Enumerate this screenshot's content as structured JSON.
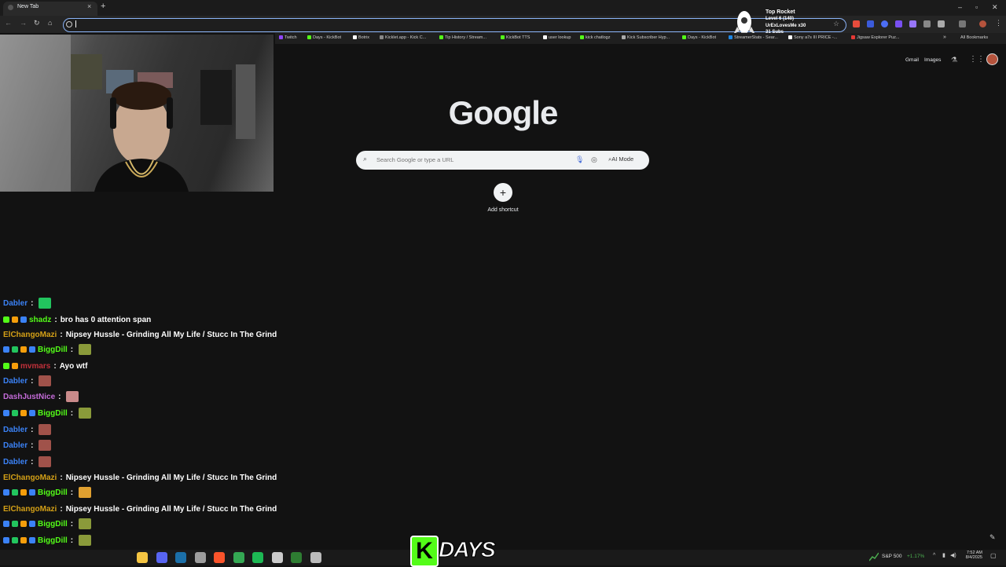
{
  "browser": {
    "tab_title": "New Tab",
    "tab_close": "×",
    "new_tab": "+",
    "bookmarks": [
      {
        "label": "Twitch",
        "color": "#9146ff"
      },
      {
        "label": "Days - KickBot",
        "color": "#53fc18"
      },
      {
        "label": "Botrix",
        "color": "#ffffff"
      },
      {
        "label": "Kicklet.app - Kick C...",
        "color": "#888888"
      },
      {
        "label": "Tip History / Stream...",
        "color": "#53fc18"
      },
      {
        "label": "KickBot TTS",
        "color": "#53fc18"
      },
      {
        "label": "user lookup",
        "color": "#ffffff"
      },
      {
        "label": "kick chatlogz",
        "color": "#53fc18"
      },
      {
        "label": "Kick Subscriber Hyp...",
        "color": "#aaaaaa"
      },
      {
        "label": "Days - KickBot",
        "color": "#53fc18"
      },
      {
        "label": "StreamerStats - Sear...",
        "color": "#1e88e5"
      },
      {
        "label": "Sony a7s III PRICE -...",
        "color": "#ffffff"
      },
      {
        "label": "Jigsaw Explorer Puz...",
        "color": "#e53935"
      }
    ],
    "all_bookmarks": "All Bookmarks",
    "more_bookmarks": "»"
  },
  "rocket_overlay": {
    "title": "Top Rocket",
    "lines": [
      "Level 6 (140)",
      "UrExLovesMe x30",
      "31 Subs"
    ]
  },
  "google": {
    "gmail": "Gmail",
    "images": "Images",
    "logo": "Google",
    "search_placeholder": "Search Google or type a URL",
    "ai_mode": "AI Mode",
    "add_shortcut_icon": "+",
    "add_shortcut_label": "Add shortcut"
  },
  "chat": [
    {
      "user": "Dabler",
      "color": "#3b82f6",
      "badges": [],
      "message": "",
      "emote": "#22c55e"
    },
    {
      "user": "shadz",
      "color": "#53fc18",
      "badges": [
        "#53fc18",
        "#f59e0b",
        "#3b82f6"
      ],
      "message": "bro has 0 attention span",
      "emote": ""
    },
    {
      "user": "ElChangoMazi",
      "color": "#d4a017",
      "badges": [],
      "message": "Nipsey Hussle - Grinding All My Life / Stucc In The Grind",
      "emote": ""
    },
    {
      "user": "BiggDill",
      "color": "#53fc18",
      "badges": [
        "#3b82f6",
        "#22c55e",
        "#f59e0b",
        "#3b82f6"
      ],
      "message": "",
      "emote": "#8a9a3a"
    },
    {
      "user": "mvmars",
      "color": "#c0303a",
      "badges": [
        "#53fc18",
        "#f59e0b"
      ],
      "message": "Ayo wtf",
      "emote": ""
    },
    {
      "user": "Dabler",
      "color": "#3b82f6",
      "badges": [],
      "message": "",
      "emote": "#a0524a"
    },
    {
      "user": "DashJustNice",
      "color": "#c46bd8",
      "badges": [],
      "message": "",
      "emote": "#c98a8a"
    },
    {
      "user": "BiggDill",
      "color": "#53fc18",
      "badges": [
        "#3b82f6",
        "#22c55e",
        "#f59e0b",
        "#3b82f6"
      ],
      "message": "",
      "emote": "#8a9a3a"
    },
    {
      "user": "Dabler",
      "color": "#3b82f6",
      "badges": [],
      "message": "",
      "emote": "#a0524a"
    },
    {
      "user": "Dabler",
      "color": "#3b82f6",
      "badges": [],
      "message": "",
      "emote": "#a0524a"
    },
    {
      "user": "Dabler",
      "color": "#3b82f6",
      "badges": [],
      "message": "",
      "emote": "#a0524a"
    },
    {
      "user": "ElChangoMazi",
      "color": "#d4a017",
      "badges": [],
      "message": "Nipsey Hussle - Grinding All My Life / Stucc In The Grind",
      "emote": ""
    },
    {
      "user": "BiggDill",
      "color": "#53fc18",
      "badges": [
        "#3b82f6",
        "#22c55e",
        "#f59e0b",
        "#3b82f6"
      ],
      "message": "",
      "emote": "#e0a030"
    },
    {
      "user": "ElChangoMazi",
      "color": "#d4a017",
      "badges": [],
      "message": "Nipsey Hussle - Grinding All My Life / Stucc In The Grind",
      "emote": ""
    },
    {
      "user": "BiggDill",
      "color": "#53fc18",
      "badges": [
        "#3b82f6",
        "#22c55e",
        "#f59e0b",
        "#3b82f6"
      ],
      "message": "",
      "emote": "#8a9a3a"
    },
    {
      "user": "BiggDill",
      "color": "#53fc18",
      "badges": [
        "#3b82f6",
        "#22c55e",
        "#f59e0b",
        "#3b82f6"
      ],
      "message": "",
      "emote": "#8a9a3a"
    },
    {
      "user": "BiggDill",
      "color": "#53fc18",
      "badges": [
        "#3b82f6",
        "#22c55e",
        "#f59e0b",
        "#3b82f6"
      ],
      "message": "",
      "emote": "#e0a030"
    }
  ],
  "chat_separator": ":",
  "taskbar": {
    "icons": [
      {
        "name": "file-explorer-icon",
        "color": "#f5c542"
      },
      {
        "name": "discord-icon",
        "color": "#5865f2"
      },
      {
        "name": "steam-icon",
        "color": "#1b6fa8"
      },
      {
        "name": "settings-icon",
        "color": "#9e9e9e"
      },
      {
        "name": "brave-icon",
        "color": "#fb542b"
      },
      {
        "name": "chrome-icon",
        "color": "#34a853"
      },
      {
        "name": "spotify-icon",
        "color": "#1db954"
      },
      {
        "name": "streamlabs-icon",
        "color": "#cccccc"
      },
      {
        "name": "terminal-icon",
        "color": "#2e7d32"
      },
      {
        "name": "obs-icon",
        "color": "#bbbbbb"
      }
    ],
    "stock_label": "S&P 500",
    "stock_change": "+1.17%",
    "time": "7:52 AM",
    "date": "8/4/2025"
  },
  "overlay_logo": {
    "letter": "K",
    "text": "DAYS"
  }
}
